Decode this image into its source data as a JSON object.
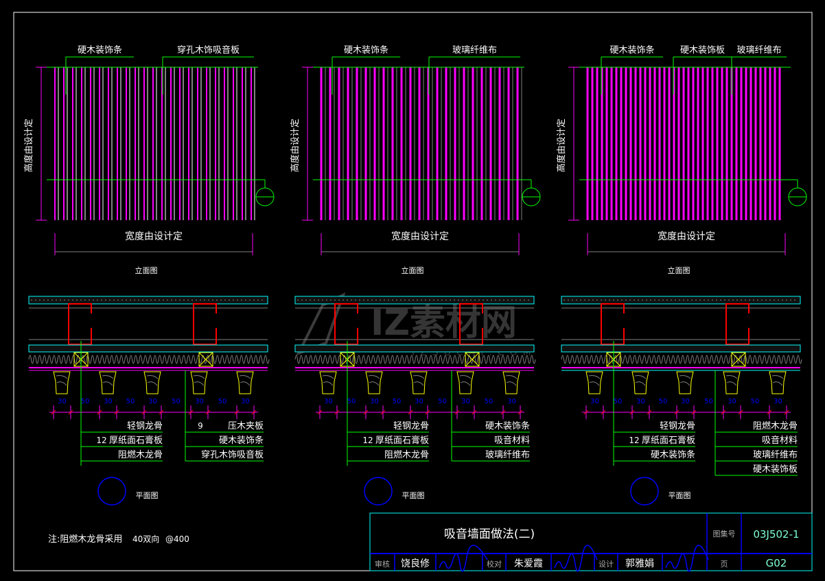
{
  "watermark": {
    "text": "IZ素材网",
    "subtext": "IZSUCAI.COM"
  },
  "panels": [
    {
      "elevation_labels": [
        "硬木装饰条",
        "穿孔木饰吸音板"
      ],
      "height_label": "高度由设计定",
      "width_label": "宽度由设计定",
      "elevation_title": "立面图",
      "dims": [
        "30",
        "50",
        "30",
        "50",
        "30",
        "50",
        "30",
        "50",
        "30"
      ],
      "left_callouts": [
        {
          "num": "",
          "text": "轻钢龙骨"
        },
        {
          "num": "12",
          "text": "厚纸面石膏板"
        },
        {
          "num": "",
          "text": "阻燃木龙骨"
        }
      ],
      "right_callouts": [
        {
          "num": "9",
          "text": "压木夹板"
        },
        {
          "num": "",
          "text": "硬木装饰条"
        },
        {
          "num": "",
          "text": "穿孔木饰吸音板"
        }
      ],
      "plan_title": "平面图"
    },
    {
      "elevation_labels": [
        "硬木装饰条",
        "玻璃纤维布"
      ],
      "height_label": "高度由设计定",
      "width_label": "宽度由设计定",
      "elevation_title": "立面图",
      "dims": [
        "30",
        "50",
        "30",
        "50",
        "30",
        "50",
        "30",
        "50",
        "30"
      ],
      "left_callouts": [
        {
          "num": "",
          "text": "轻钢龙骨"
        },
        {
          "num": "12",
          "text": "厚纸面石膏板"
        },
        {
          "num": "",
          "text": "阻燃木龙骨"
        }
      ],
      "right_callouts": [
        {
          "num": "",
          "text": "硬木装饰条"
        },
        {
          "num": "",
          "text": "吸音材料"
        },
        {
          "num": "",
          "text": "玻璃纤维布"
        }
      ],
      "plan_title": "平面图"
    },
    {
      "elevation_labels": [
        "硬木装饰条",
        "硬木装饰板",
        "玻璃纤维布"
      ],
      "height_label": "高度由设计定",
      "width_label": "宽度由设计定",
      "elevation_title": "立面图",
      "dims": [
        "30",
        "50",
        "30",
        "50",
        "30",
        "50",
        "30",
        "50",
        "30"
      ],
      "left_callouts": [
        {
          "num": "",
          "text": "轻钢龙骨"
        },
        {
          "num": "12",
          "text": "厚纸面石膏板"
        },
        {
          "num": "",
          "text": "硬木装饰条"
        }
      ],
      "right_callouts": [
        {
          "num": "",
          "text": "阻燃木龙骨"
        },
        {
          "num": "",
          "text": "吸音材料"
        },
        {
          "num": "",
          "text": "玻璃纤维布"
        },
        {
          "num": "",
          "text": "硬木装饰板"
        }
      ],
      "plan_title": "平面图"
    }
  ],
  "note": {
    "prefix": "注:阻燃木龙骨采用",
    "size": "40双向",
    "spacing": "@400"
  },
  "title_block": {
    "title": "吸音墙面做法(二)",
    "atlas_label": "图集号",
    "atlas_no": "03J502-1",
    "page_label": "页",
    "page_no": "G02",
    "review_label": "审核",
    "reviewer": "饶良修",
    "check_label": "校对",
    "checker": "朱爱霞",
    "design_label": "设计",
    "designer": "郭雅娟"
  },
  "colors": {
    "frame": "#ffffff",
    "title_block": "#00ffff",
    "blue": "#0000ff",
    "green": "#00ff00",
    "magenta": "#ff00ff",
    "red": "#ff0000",
    "yellow": "#ffff00",
    "cyan": "#00ffff",
    "gray": "#808080",
    "text": "#ffffff"
  }
}
